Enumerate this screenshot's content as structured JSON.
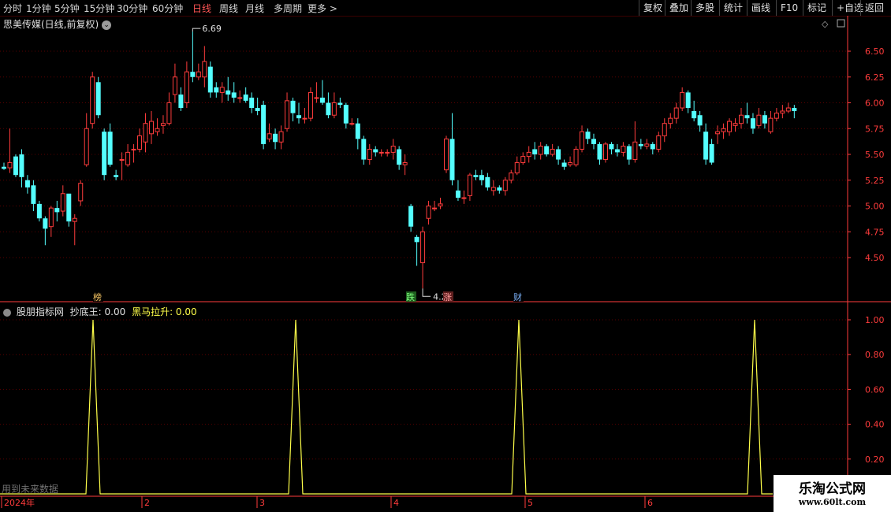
{
  "toolbar": {
    "periods": [
      "分时",
      "1分钟",
      "5分钟",
      "15分钟",
      "30分钟",
      "60分钟",
      "日线",
      "周线",
      "月线",
      "多周期",
      "更多 >"
    ],
    "active_period": "日线",
    "right_buttons": [
      "复权",
      "叠加",
      "多股",
      "统计",
      "画线",
      "F10",
      "标记",
      "+自选",
      "返回"
    ]
  },
  "stock_title": "思美传媒(日线,前复权)",
  "price_axis": [
    "6.50",
    "6.25",
    "6.00",
    "5.75",
    "5.50",
    "5.25",
    "5.00",
    "4.75",
    "4.50"
  ],
  "annotations": {
    "high": "6.69",
    "low": "4.20"
  },
  "markers": [
    "榜",
    "跌",
    "涨",
    "财"
  ],
  "indicator": {
    "name": "股朋指标网",
    "line1_label": "抄底王: 0.00",
    "line2_label": "黑马拉升: 0.00",
    "axis": [
      "1.00",
      "0.80",
      "0.60",
      "0.40",
      "0.20"
    ]
  },
  "future_note": "用到未来数据",
  "date_axis": [
    "2024年",
    "2",
    "3",
    "4",
    "5",
    "6"
  ],
  "watermark": {
    "title": "乐淘公式网",
    "url": "www.60lt.com"
  },
  "colors": {
    "up": "#ff3c3c",
    "down": "#54ffff",
    "signal": "#ffff4a",
    "grid": "#5a0000",
    "axis": "#ff3c3c"
  },
  "chart_data": {
    "type": "candlestick",
    "candles": [
      [
        5.38,
        5.36,
        5.42,
        5.35
      ],
      [
        5.37,
        5.42,
        5.75,
        5.32
      ],
      [
        5.48,
        5.3,
        5.5,
        5.28
      ],
      [
        5.5,
        5.28,
        5.55,
        5.18
      ],
      [
        5.25,
        5.18,
        5.3,
        5.12
      ],
      [
        5.2,
        5.02,
        5.25,
        4.95
      ],
      [
        5.02,
        4.88,
        5.05,
        4.85
      ],
      [
        4.88,
        4.78,
        4.9,
        4.62
      ],
      [
        4.8,
        4.98,
        5.0,
        4.7
      ],
      [
        4.98,
        4.94,
        5.05,
        4.85
      ],
      [
        4.95,
        5.12,
        5.2,
        4.9
      ],
      [
        5.12,
        4.85,
        5.1,
        4.8
      ],
      [
        4.85,
        4.88,
        4.92,
        4.62
      ],
      [
        5.05,
        5.22,
        5.25,
        5.0
      ],
      [
        5.4,
        5.75,
        5.9,
        5.38
      ],
      [
        5.8,
        6.25,
        6.3,
        5.75
      ],
      [
        6.2,
        5.88,
        6.25,
        5.85
      ],
      [
        5.72,
        5.3,
        5.75,
        5.25
      ],
      [
        5.72,
        5.4,
        5.8,
        5.38
      ],
      [
        5.3,
        5.28,
        5.35,
        5.25
      ],
      [
        5.45,
        5.45,
        5.52,
        5.25
      ],
      [
        5.4,
        5.52,
        5.6,
        5.38
      ],
      [
        5.55,
        5.55,
        5.6,
        5.42
      ],
      [
        5.55,
        5.68,
        5.75,
        5.52
      ],
      [
        5.62,
        5.8,
        5.9,
        5.52
      ],
      [
        5.7,
        5.82,
        5.92,
        5.6
      ],
      [
        5.72,
        5.75,
        5.85,
        5.68
      ],
      [
        5.78,
        5.8,
        5.88,
        5.7
      ],
      [
        5.8,
        6.0,
        6.1,
        5.78
      ],
      [
        6.08,
        6.25,
        6.38,
        6.0
      ],
      [
        6.08,
        5.95,
        6.15,
        5.92
      ],
      [
        6.0,
        6.3,
        6.4,
        5.95
      ],
      [
        6.3,
        6.25,
        6.69,
        6.2
      ],
      [
        6.25,
        6.3,
        6.38,
        6.22
      ],
      [
        6.25,
        6.4,
        6.55,
        6.15
      ],
      [
        6.35,
        6.1,
        6.4,
        6.05
      ],
      [
        6.15,
        6.1,
        6.2,
        6.05
      ],
      [
        6.1,
        6.15,
        6.2,
        6.0
      ],
      [
        6.12,
        6.08,
        6.25,
        6.02
      ],
      [
        6.1,
        6.05,
        6.2,
        6.0
      ],
      [
        6.05,
        6.05,
        6.12,
        6.0
      ],
      [
        6.08,
        6.02,
        6.15,
        6.0
      ],
      [
        6.05,
        5.95,
        6.1,
        5.9
      ],
      [
        5.95,
        5.92,
        6.05,
        5.88
      ],
      [
        5.98,
        5.6,
        6.02,
        5.55
      ],
      [
        5.65,
        5.7,
        5.8,
        5.62
      ],
      [
        5.7,
        5.62,
        5.75,
        5.55
      ],
      [
        5.62,
        5.72,
        5.78,
        5.55
      ],
      [
        5.75,
        6.02,
        6.1,
        5.72
      ],
      [
        6.02,
        5.9,
        6.05,
        5.82
      ],
      [
        5.88,
        5.85,
        6.0,
        5.8
      ],
      [
        5.85,
        5.85,
        5.95,
        5.8
      ],
      [
        5.85,
        6.1,
        6.15,
        5.82
      ],
      [
        6.05,
        6.05,
        6.2,
        6.0
      ],
      [
        6.05,
        6.0,
        6.22,
        5.98
      ],
      [
        6.0,
        5.88,
        6.1,
        5.85
      ],
      [
        5.88,
        6.0,
        6.1,
        5.85
      ],
      [
        6.0,
        5.98,
        6.05,
        5.95
      ],
      [
        5.98,
        5.8,
        6.0,
        5.75
      ],
      [
        5.8,
        5.8,
        5.85,
        5.78
      ],
      [
        5.8,
        5.65,
        5.85,
        5.55
      ],
      [
        5.65,
        5.45,
        5.68,
        5.4
      ],
      [
        5.45,
        5.55,
        5.6,
        5.4
      ],
      [
        5.55,
        5.52,
        5.58,
        5.48
      ],
      [
        5.52,
        5.52,
        5.55,
        5.48
      ],
      [
        5.52,
        5.52,
        5.55,
        5.48
      ],
      [
        5.52,
        5.58,
        5.65,
        5.45
      ],
      [
        5.55,
        5.4,
        5.58,
        5.35
      ],
      [
        5.4,
        5.42,
        5.5,
        5.3
      ],
      [
        5.0,
        4.8,
        5.02,
        4.75
      ],
      [
        4.7,
        4.65,
        4.72,
        4.42
      ],
      [
        4.45,
        4.75,
        4.8,
        4.2
      ],
      [
        4.88,
        5.0,
        5.05,
        4.82
      ],
      [
        4.98,
        4.98,
        5.05,
        4.95
      ],
      [
        5.0,
        5.02,
        5.08,
        4.97
      ],
      [
        5.35,
        5.65,
        5.68,
        5.32
      ],
      [
        5.65,
        5.25,
        5.9,
        5.2
      ],
      [
        5.15,
        5.08,
        5.25,
        5.05
      ],
      [
        5.08,
        5.08,
        5.15,
        5.02
      ],
      [
        5.1,
        5.3,
        5.32,
        5.05
      ],
      [
        5.3,
        5.28,
        5.35,
        5.25
      ],
      [
        5.3,
        5.25,
        5.35,
        5.2
      ],
      [
        5.28,
        5.18,
        5.32,
        5.15
      ],
      [
        5.15,
        5.18,
        5.25,
        5.1
      ],
      [
        5.18,
        5.15,
        5.2,
        5.12
      ],
      [
        5.15,
        5.25,
        5.28,
        5.1
      ],
      [
        5.25,
        5.32,
        5.35,
        5.22
      ],
      [
        5.32,
        5.42,
        5.48,
        5.3
      ],
      [
        5.42,
        5.48,
        5.52,
        5.4
      ],
      [
        5.48,
        5.52,
        5.58,
        5.42
      ],
      [
        5.55,
        5.5,
        5.62,
        5.45
      ],
      [
        5.5,
        5.58,
        5.62,
        5.45
      ],
      [
        5.58,
        5.5,
        5.6,
        5.48
      ],
      [
        5.5,
        5.55,
        5.6,
        5.48
      ],
      [
        5.55,
        5.45,
        5.58,
        5.4
      ],
      [
        5.42,
        5.38,
        5.45,
        5.35
      ],
      [
        5.4,
        5.42,
        5.48,
        5.38
      ],
      [
        5.4,
        5.55,
        5.58,
        5.38
      ],
      [
        5.55,
        5.72,
        5.78,
        5.52
      ],
      [
        5.72,
        5.65,
        5.75,
        5.6
      ],
      [
        5.65,
        5.6,
        5.7,
        5.55
      ],
      [
        5.6,
        5.45,
        5.62,
        5.4
      ],
      [
        5.45,
        5.6,
        5.62,
        5.42
      ],
      [
        5.6,
        5.55,
        5.62,
        5.5
      ],
      [
        5.55,
        5.52,
        5.6,
        5.48
      ],
      [
        5.52,
        5.58,
        5.62,
        5.48
      ],
      [
        5.58,
        5.45,
        5.6,
        5.4
      ],
      [
        5.45,
        5.62,
        5.82,
        5.42
      ],
      [
        5.6,
        5.58,
        5.65,
        5.55
      ],
      [
        5.58,
        5.6,
        5.65,
        5.55
      ],
      [
        5.6,
        5.55,
        5.62,
        5.5
      ],
      [
        5.55,
        5.68,
        5.72,
        5.52
      ],
      [
        5.68,
        5.8,
        5.85,
        5.62
      ],
      [
        5.8,
        5.85,
        5.9,
        5.75
      ],
      [
        5.85,
        5.95,
        6.0,
        5.8
      ],
      [
        5.95,
        6.1,
        6.15,
        5.92
      ],
      [
        6.1,
        5.95,
        6.12,
        5.9
      ],
      [
        5.92,
        5.85,
        6.02,
        5.82
      ],
      [
        5.88,
        5.78,
        5.92,
        5.72
      ],
      [
        5.72,
        5.45,
        5.8,
        5.4
      ],
      [
        5.6,
        5.42,
        5.65,
        5.4
      ],
      [
        5.7,
        5.72,
        5.78,
        5.6
      ],
      [
        5.72,
        5.75,
        5.8,
        5.65
      ],
      [
        5.72,
        5.82,
        5.85,
        5.68
      ],
      [
        5.78,
        5.8,
        5.85,
        5.72
      ],
      [
        5.8,
        5.88,
        5.95,
        5.75
      ],
      [
        5.88,
        5.85,
        6.0,
        5.8
      ],
      [
        5.85,
        5.75,
        5.9,
        5.7
      ],
      [
        5.78,
        5.88,
        5.95,
        5.75
      ],
      [
        5.88,
        5.8,
        5.92,
        5.75
      ],
      [
        5.72,
        5.85,
        5.92,
        5.7
      ],
      [
        5.85,
        5.9,
        5.95,
        5.82
      ],
      [
        5.9,
        5.92,
        5.98,
        5.85
      ],
      [
        5.92,
        5.95,
        6.0,
        5.9
      ],
      [
        5.95,
        5.92,
        5.98,
        5.85
      ]
    ],
    "x_labels": [
      "2024年",
      "2",
      "3",
      "4",
      "5",
      "6"
    ],
    "ylim": [
      4.2,
      6.69
    ],
    "indicator_signals": [
      {
        "x_pos": 118,
        "value": 1.0
      },
      {
        "x_pos": 375,
        "value": 1.0
      },
      {
        "x_pos": 658,
        "value": 1.0
      },
      {
        "x_pos": 957,
        "value": 1.0
      }
    ],
    "indicator_ylim": [
      0,
      1
    ]
  }
}
